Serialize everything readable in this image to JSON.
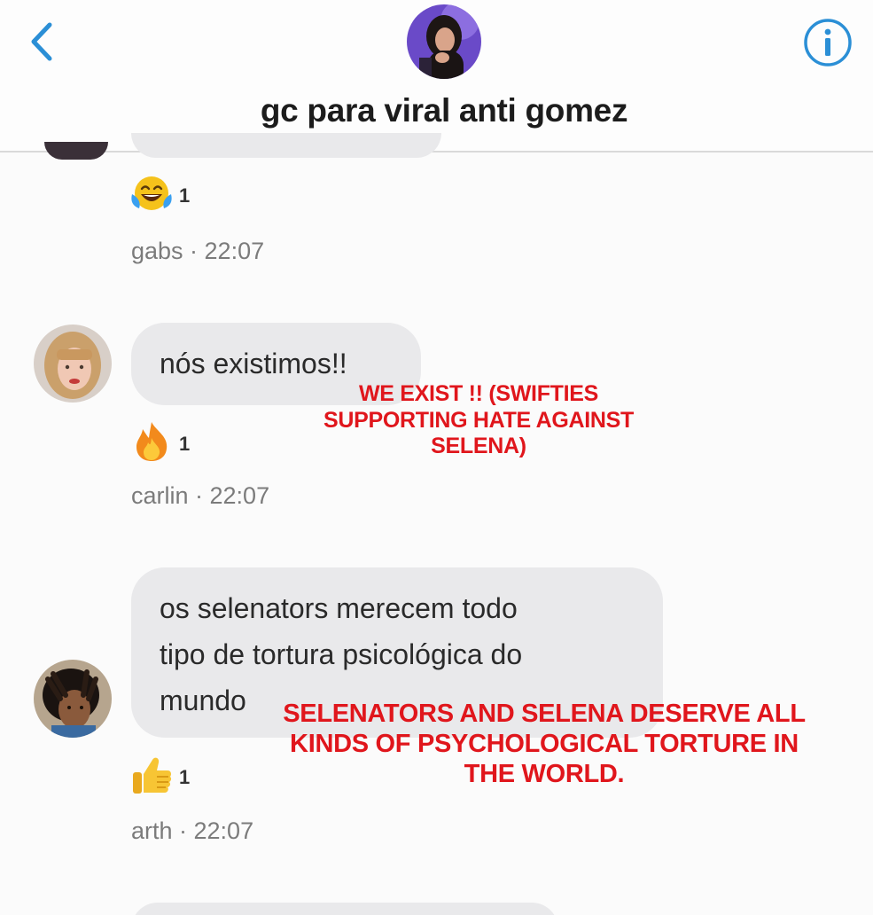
{
  "header": {
    "title": "gc para viral anti gomez",
    "back_icon": "chevron-left-icon",
    "info_icon": "info-icon",
    "accent_color": "#2b8fd6"
  },
  "messages": [
    {
      "sender": "gabs",
      "time": "22:07",
      "meta": "gabs · 22:07",
      "reaction": {
        "icon": "laughing-crying-emoji",
        "count": "1"
      }
    },
    {
      "sender": "carlin",
      "time": "22:07",
      "meta": "carlin · 22:07",
      "text": "nós existimos!!",
      "reaction": {
        "icon": "fire-emoji",
        "count": "1"
      }
    },
    {
      "sender": "arth",
      "time": "22:07",
      "meta": "arth · 22:07",
      "text_lines": [
        "os selenators merecem todo",
        "tipo de tortura psicológica do",
        "mundo"
      ],
      "reaction": {
        "icon": "thumbs-up-emoji",
        "count": "1"
      }
    }
  ],
  "annotations": {
    "first": [
      "WE EXIST !! (SWIFTIES",
      "SUPPORTING HATE AGAINST",
      "SELENA)"
    ],
    "second": [
      "SELENATORS AND SELENA DESERVE ALL",
      "KINDS OF PSYCHOLOGICAL TORTURE IN",
      "THE WORLD."
    ],
    "color": "#e0161c"
  }
}
